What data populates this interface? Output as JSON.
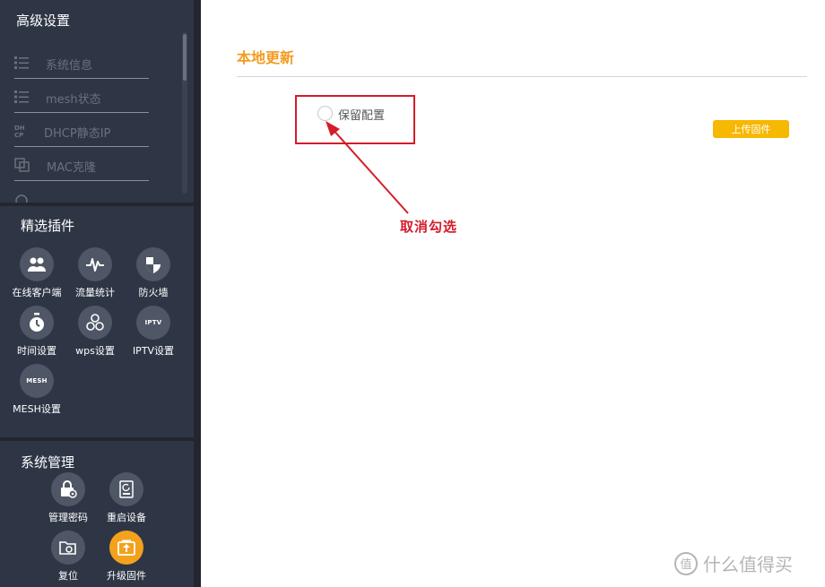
{
  "sidebar": {
    "advanced": {
      "title": "高级设置",
      "items": [
        {
          "label": "系统信息",
          "icon": "list-icon"
        },
        {
          "label": "mesh状态",
          "icon": "list-icon"
        },
        {
          "label": "DHCP静态IP",
          "icon": "dhcp-icon"
        },
        {
          "label": "MAC克隆",
          "icon": "clone-icon"
        },
        {
          "label": "",
          "icon": "globe-icon"
        }
      ]
    },
    "plugins": {
      "title": "精选插件",
      "items": [
        {
          "label": "在线客户端",
          "icon": "users-icon"
        },
        {
          "label": "流量统计",
          "icon": "pulse-icon"
        },
        {
          "label": "防火墙",
          "icon": "shield-icon"
        },
        {
          "label": "时间设置",
          "icon": "clock-icon"
        },
        {
          "label": "wps设置",
          "icon": "wps-icon"
        },
        {
          "label": "IPTV设置",
          "icon": "iptv-icon",
          "badge": "IPTV"
        },
        {
          "label": "MESH设置",
          "icon": "mesh-icon",
          "badge": "MESH"
        }
      ]
    },
    "system": {
      "title": "系统管理",
      "items": [
        {
          "label": "管理密码",
          "icon": "lock-gear-icon"
        },
        {
          "label": "重启设备",
          "icon": "restart-icon"
        },
        {
          "label": "复位",
          "icon": "reset-icon"
        },
        {
          "label": "升级固件",
          "icon": "upgrade-icon",
          "active": true
        }
      ]
    }
  },
  "main": {
    "title": "本地更新",
    "option_label": "保留配置",
    "upload_button": "上传固件",
    "annotation": "取消勾选"
  },
  "watermark": {
    "logo": "值",
    "text": "什么值得买"
  },
  "colors": {
    "sidebar_bg": "#2e3646",
    "accent_orange": "#f39b1f",
    "button_yellow": "#f6b800",
    "annotation_red": "#d41c2a"
  }
}
